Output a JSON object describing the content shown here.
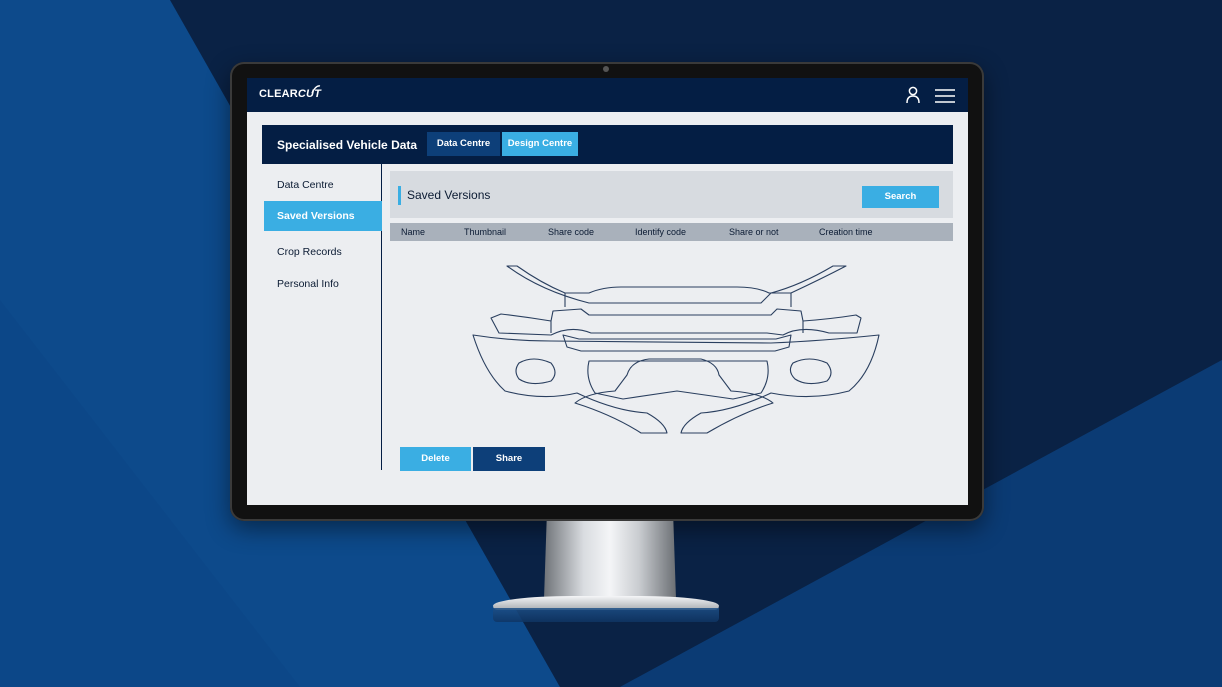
{
  "brand": {
    "logo_text_a": "CLEAR",
    "logo_text_b": "CUT"
  },
  "header": {
    "title": "Specialised Vehicle Data",
    "tabs": [
      "Data Centre",
      "Design Centre"
    ],
    "active_tab": "Design Centre"
  },
  "icons": {
    "user": "user-icon",
    "menu": "hamburger-menu-icon"
  },
  "sidebar": {
    "items": [
      {
        "label": "Data Centre",
        "active": false
      },
      {
        "label": "Saved Versions",
        "active": true
      },
      {
        "label": "Crop Records",
        "active": false
      },
      {
        "label": "Personal Info",
        "active": false
      }
    ]
  },
  "panel": {
    "title": "Saved Versions",
    "search_label": "Search"
  },
  "table": {
    "columns": [
      "Name",
      "Thumbnail",
      "Share code",
      "Identify code",
      "Share or not",
      "Creation time"
    ]
  },
  "actions": {
    "delete_label": "Delete",
    "share_label": "Share"
  },
  "colors": {
    "navy": "#041e44",
    "accent_blue": "#3aaee3",
    "dark_button_blue": "#0d3f79",
    "screen_bg": "#eceef1"
  }
}
